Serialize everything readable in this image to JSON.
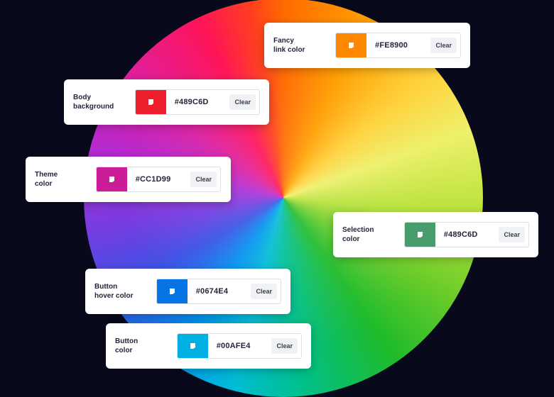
{
  "cards": [
    {
      "label": "Fancy\nlink color",
      "swatch_color": "#FE8900",
      "value": "#FE8900",
      "clear_label": "Clear",
      "icon": "color-swatch-icon"
    },
    {
      "label": "Body\nbackground",
      "swatch_color": "#EE1E2E",
      "value": "#489C6D",
      "clear_label": "Clear",
      "icon": "color-swatch-icon"
    },
    {
      "label": "Theme\ncolor",
      "swatch_color": "#CC1D99",
      "value": "#CC1D99",
      "clear_label": "Clear",
      "icon": "color-swatch-icon"
    },
    {
      "label": "Selection\ncolor",
      "swatch_color": "#489C6D",
      "value": "#489C6D",
      "clear_label": "Clear",
      "icon": "color-swatch-icon"
    },
    {
      "label": "Button\nhover color",
      "swatch_color": "#0674E4",
      "value": "#0674E4",
      "clear_label": "Clear",
      "icon": "color-swatch-icon"
    },
    {
      "label": "Button\ncolor",
      "swatch_color": "#00AFE4",
      "value": "#00AFE4",
      "clear_label": "Clear",
      "icon": "color-swatch-icon"
    }
  ]
}
